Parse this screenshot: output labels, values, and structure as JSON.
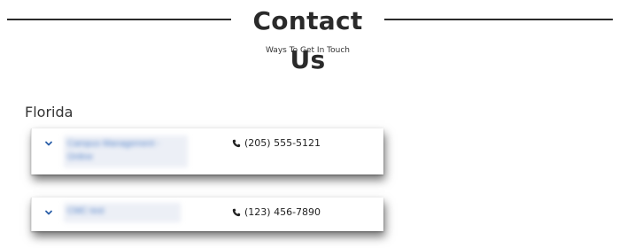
{
  "header": {
    "title": "Contact Us",
    "subtitle": "Ways To Get In Touch"
  },
  "section": {
    "state": "Florida"
  },
  "contacts": [
    {
      "name": "Campus Management - Online",
      "phone": "(205) 555-5121",
      "expand_icon": "chevron-down-icon",
      "phone_icon": "phone-icon"
    },
    {
      "name": "CMC test",
      "phone": "(123) 456-7890",
      "expand_icon": "chevron-down-icon",
      "phone_icon": "phone-icon"
    }
  ],
  "colors": {
    "accent": "#2b5fa8",
    "link_blurred": "#4f7fc7",
    "rule": "#2b2b2b"
  }
}
